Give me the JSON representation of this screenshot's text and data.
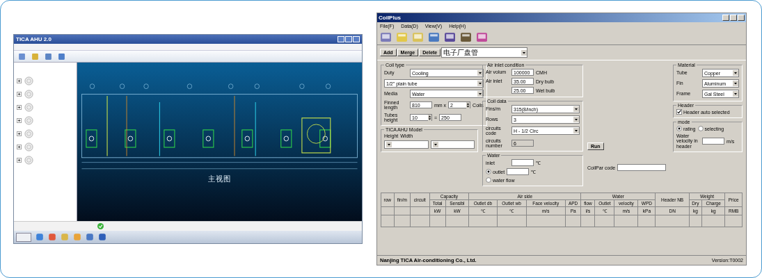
{
  "left_window": {
    "title": "TICA AHU 2.0",
    "tree": [
      {
        "expanded": false
      },
      {
        "expanded": false
      },
      {
        "expanded": false
      },
      {
        "expanded": false
      },
      {
        "expanded": false
      },
      {
        "expanded": false
      },
      {
        "expanded": false
      }
    ],
    "caption": "主视图"
  },
  "right_window": {
    "title": "CoilPlus",
    "menu": [
      "File(F)",
      "Data(D)",
      "View(V)",
      "Help(H)"
    ],
    "action_buttons": [
      "Add",
      "Merge",
      "Delete"
    ],
    "project": "电子厂盘管",
    "columns": [
      [
        {
          "title": "Coil type",
          "rows": [
            [
              {
                "kind": "label",
                "text": "Duty"
              },
              {
                "kind": "dropdown",
                "text": "Cooling"
              }
            ],
            [
              {
                "kind": "dropdown",
                "text": "1/2\" plain tube"
              }
            ],
            [
              {
                "kind": "label",
                "text": "Media"
              },
              {
                "kind": "dropdown",
                "text": "Water"
              }
            ],
            [
              {
                "kind": "label",
                "text": "Finned length"
              },
              {
                "kind": "field",
                "text": "810"
              },
              {
                "kind": "unit",
                "text": "mm x"
              },
              {
                "kind": "spin",
                "text": "2"
              },
              {
                "kind": "unit",
                "text": "Coils"
              }
            ],
            [
              {
                "kind": "label",
                "text": "Tubes height"
              },
              {
                "kind": "spin",
                "text": "10"
              },
              {
                "kind": "unit",
                "text": "="
              },
              {
                "kind": "field",
                "text": "250"
              }
            ]
          ]
        },
        {
          "title": "TICA AHU Model",
          "rows": [
            [
              {
                "kind": "unit",
                "text": "Height"
              },
              {
                "kind": "unit",
                "text": "Width"
              }
            ],
            [
              {
                "kind": "dropdown"
              },
              {
                "kind": "dropdown"
              }
            ]
          ]
        }
      ],
      [
        {
          "title": "Air inlet condition",
          "rows": [
            [
              {
                "kind": "label",
                "text": "Air volum"
              },
              {
                "kind": "field",
                "text": "100000"
              },
              {
                "kind": "unit",
                "text": "CMH"
              }
            ],
            [
              {
                "kind": "label",
                "text": "Air inlet"
              },
              {
                "kind": "field",
                "text": "35.00"
              },
              {
                "kind": "unit",
                "text": "Dry bulb"
              }
            ],
            [
              {
                "kind": "label"
              },
              {
                "kind": "field",
                "text": "25.00"
              },
              {
                "kind": "unit",
                "text": "Wet bulb"
              }
            ]
          ]
        },
        {
          "title": "Coil data",
          "rows": [
            [
              {
                "kind": "label",
                "text": "Fins/m"
              },
              {
                "kind": "dropdown",
                "text": "315(8/inch)"
              }
            ],
            [
              {
                "kind": "label",
                "text": "Rows"
              },
              {
                "kind": "dropdown",
                "text": "3"
              }
            ],
            [
              {
                "kind": "label",
                "text": "circuits code"
              },
              {
                "kind": "dropdown",
                "text": "H - 1/2 Circ"
              }
            ],
            [
              {
                "kind": "label",
                "text": "circuits number"
              },
              {
                "kind": "readonly",
                "text": "6"
              }
            ]
          ]
        },
        {
          "title": "Water",
          "rows": [
            [
              {
                "kind": "label",
                "text": "inlet"
              },
              {
                "kind": "field"
              },
              {
                "kind": "unit",
                "text": "℃"
              }
            ],
            [
              {
                "kind": "radio",
                "text": "outlet",
                "selected": true
              },
              {
                "kind": "field"
              },
              {
                "kind": "unit",
                "text": "℃"
              }
            ],
            [
              {
                "kind": "radio",
                "text": "water flow",
                "selected": false
              }
            ]
          ]
        }
      ],
      [
        {
          "title": "Material",
          "rows": [
            [
              {
                "kind": "label",
                "text": "Tube"
              },
              {
                "kind": "dropdown",
                "text": "Copper"
              }
            ],
            [
              {
                "kind": "label",
                "text": "Fin"
              },
              {
                "kind": "dropdown",
                "text": "Aluminum"
              }
            ],
            [
              {
                "kind": "label",
                "text": "Frame"
              },
              {
                "kind": "dropdown",
                "text": "Gal Steel"
              }
            ]
          ]
        },
        {
          "title": "Header",
          "rows": [
            [
              {
                "kind": "checkbox",
                "text": "Header auto selected",
                "checked": true
              }
            ]
          ]
        },
        {
          "title": "mode",
          "rows": [
            [
              {
                "kind": "radio",
                "text": "rating",
                "selected": true
              },
              {
                "kind": "radio",
                "text": "selecting",
                "selected": false
              }
            ],
            [
              {
                "kind": "label",
                "text": "Water velocity in header"
              },
              {
                "kind": "field"
              },
              {
                "kind": "unit",
                "text": "m/s"
              }
            ]
          ]
        }
      ]
    ],
    "run_button": "Run",
    "coilpar_label": "CoilPar code",
    "table": [
      {
        "title": "row"
      },
      {
        "title": "fin/m"
      },
      {
        "title": "circuit"
      },
      {
        "title": "Capacity",
        "columns": [
          {
            "label": "Total",
            "unit": "kW"
          },
          {
            "label": "Sensibl",
            "unit": "kW"
          }
        ]
      },
      {
        "title": "Air side",
        "columns": [
          {
            "label": "Outlet db",
            "unit": "℃"
          },
          {
            "label": "Outlet wb",
            "unit": "℃"
          },
          {
            "label": "Face velocity",
            "unit": "m/s"
          },
          {
            "label": "APD",
            "unit": "Pa"
          }
        ]
      },
      {
        "title": "Water",
        "columns": [
          {
            "label": "flow",
            "unit": "l/s"
          },
          {
            "label": "Outlet",
            "unit": "℃"
          },
          {
            "label": "velocity",
            "unit": "m/s"
          },
          {
            "label": "WPD",
            "unit": "kPa"
          }
        ]
      },
      {
        "title": "Header NB",
        "unit": "DN"
      },
      {
        "title": "Weight",
        "columns": [
          {
            "label": "Dry",
            "unit": "kg"
          },
          {
            "label": "Charge",
            "unit": "kg"
          }
        ]
      },
      {
        "title": "Price",
        "unit": "RMB"
      }
    ],
    "company": "Nanjing TICA Air-conditioning Co., Ltd.",
    "version": "Version:T0002"
  }
}
